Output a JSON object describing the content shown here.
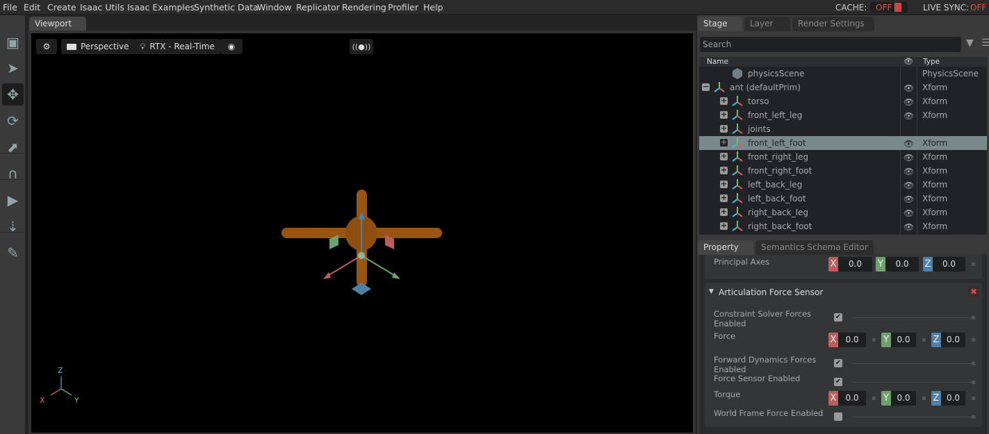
{
  "menu": [
    "File",
    "Edit",
    "Create",
    "Isaac Utils",
    "Isaac Examples",
    "Synthetic Data",
    "Window",
    "Replicator",
    "Rendering",
    "Profiler",
    "Help"
  ],
  "status": {
    "cache_label": "CACHE:",
    "cache_value": "OFF",
    "live_sync_label": "LIVE SYNC:",
    "live_sync_value": "OFF",
    "off_color": "#e05050"
  },
  "viewport": {
    "tab": "Viewport",
    "camera": "Perspective",
    "renderer": "RTX - Real-Time",
    "axes": {
      "x": "X",
      "y": "Y",
      "z": "Z"
    }
  },
  "toolbar": [
    "frame-icon",
    "select-icon",
    "move-icon",
    "rotate-icon",
    "scale-icon",
    "snap-icon",
    "play-icon",
    "physics-icon",
    "paint-icon"
  ],
  "stage": {
    "tabs": [
      "Stage",
      "Layer",
      "Render Settings"
    ],
    "search_placeholder": "Search",
    "col_name": "Name",
    "col_type": "Type",
    "rows": [
      {
        "name": "physicsScene",
        "type": "PhysicsScene",
        "depth": 1,
        "icon": "cube",
        "eye": false,
        "expander": ""
      },
      {
        "name": "ant (defaultPrim)",
        "type": "Xform",
        "depth": 0,
        "icon": "xform",
        "eye": true,
        "expander": "−"
      },
      {
        "name": "torso",
        "type": "Xform",
        "depth": 1,
        "icon": "xform",
        "eye": true,
        "expander": "+"
      },
      {
        "name": "front_left_leg",
        "type": "Xform",
        "depth": 1,
        "icon": "xform",
        "eye": true,
        "expander": "+"
      },
      {
        "name": "joints",
        "type": "",
        "depth": 1,
        "icon": "xform",
        "eye": false,
        "expander": "+"
      },
      {
        "name": "front_left_foot",
        "type": "Xform",
        "depth": 1,
        "icon": "xform",
        "eye": true,
        "expander": "+",
        "selected": true
      },
      {
        "name": "front_right_leg",
        "type": "Xform",
        "depth": 1,
        "icon": "xform",
        "eye": true,
        "expander": "+"
      },
      {
        "name": "front_right_foot",
        "type": "Xform",
        "depth": 1,
        "icon": "xform",
        "eye": true,
        "expander": "+"
      },
      {
        "name": "left_back_leg",
        "type": "Xform",
        "depth": 1,
        "icon": "xform",
        "eye": true,
        "expander": "+"
      },
      {
        "name": "left_back_foot",
        "type": "Xform",
        "depth": 1,
        "icon": "xform",
        "eye": true,
        "expander": "+"
      },
      {
        "name": "right_back_leg",
        "type": "Xform",
        "depth": 1,
        "icon": "xform",
        "eye": true,
        "expander": "+"
      },
      {
        "name": "right_back_foot",
        "type": "Xform",
        "depth": 1,
        "icon": "xform",
        "eye": true,
        "expander": "+"
      }
    ]
  },
  "property": {
    "tabs": [
      "Property",
      "Semantics Schema Editor"
    ],
    "principal_axes": {
      "label": "Principal Axes",
      "x": "0.0",
      "y": "0.0",
      "z": "0.0"
    },
    "section": "Articulation Force Sensor",
    "fields": [
      {
        "label": "Constraint Solver Forces Enabled",
        "kind": "check",
        "checked": true
      },
      {
        "label": "Force",
        "kind": "vec",
        "x": "0.0",
        "y": "0.0",
        "z": "0.0"
      },
      {
        "label": "Forward Dynamics Forces Enabled",
        "kind": "check",
        "checked": true
      },
      {
        "label": "Force Sensor Enabled",
        "kind": "check",
        "checked": true
      },
      {
        "label": "Torque",
        "kind": "vec",
        "x": "0.0",
        "y": "0.0",
        "z": "0.0"
      },
      {
        "label": "World Frame Force Enabled",
        "kind": "check",
        "checked": false
      }
    ]
  }
}
